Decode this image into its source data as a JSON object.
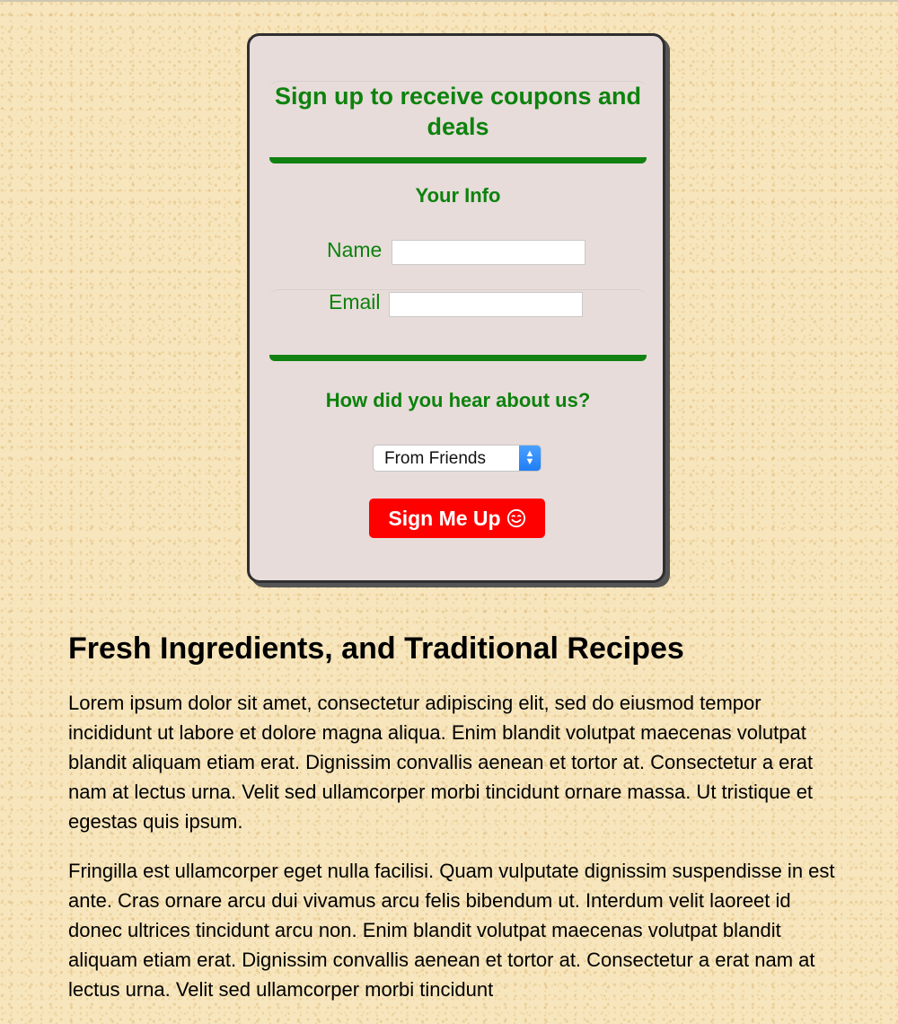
{
  "signup": {
    "title": "Sign up to receive coupons and deals",
    "info_heading": "Your Info",
    "name_label": "Name",
    "name_value": "",
    "email_label": "Email",
    "email_value": "",
    "hear_heading": "How did you hear about us?",
    "select_value": "From Friends",
    "submit_label": "Sign Me Up",
    "submit_icon": "smiley-icon"
  },
  "article": {
    "heading": "Fresh Ingredients, and Traditional Recipes",
    "paragraphs": [
      "Lorem ipsum dolor sit amet, consectetur adipiscing elit, sed do eiusmod tempor incididunt ut labore et dolore magna aliqua. Enim blandit volutpat maecenas volutpat blandit aliquam etiam erat. Dignissim convallis aenean et tortor at. Consectetur a erat nam at lectus urna. Velit sed ullamcorper morbi tincidunt ornare massa. Ut tristique et egestas quis ipsum.",
      "Fringilla est ullamcorper eget nulla facilisi. Quam vulputate dignissim suspendisse in est ante. Cras ornare arcu dui vivamus arcu felis bibendum ut. Interdum velit laoreet id donec ultrices tincidunt arcu non. Enim blandit volutpat maecenas volutpat blandit aliquam etiam erat. Dignissim convallis aenean et tortor at. Consectetur a erat nam at lectus urna. Velit sed ullamcorper morbi tincidunt"
    ]
  },
  "colors": {
    "background": "#f7e6bd",
    "card": "#e7dcda",
    "accent_green": "#0d820d",
    "button_red": "#ff0000"
  }
}
